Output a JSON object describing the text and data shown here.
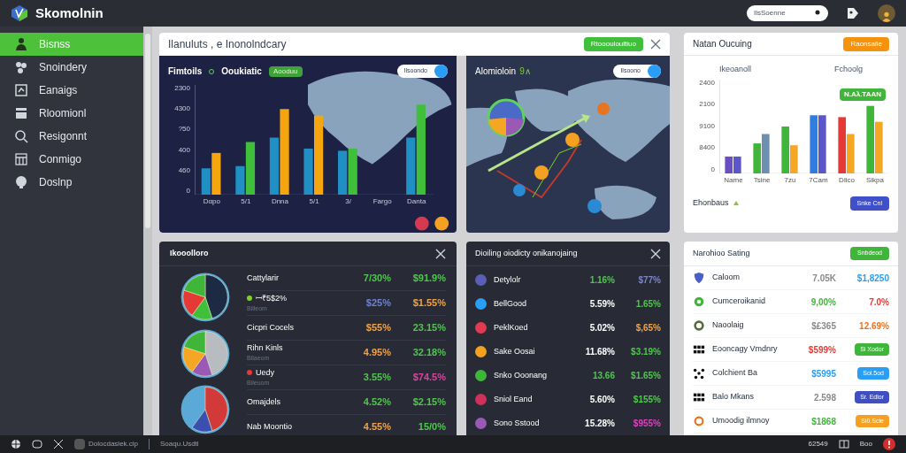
{
  "app": {
    "name": "Skomolnin"
  },
  "search": {
    "value": "IlsSoenne"
  },
  "sidebar": {
    "items": [
      {
        "label": "Bisnss",
        "selected": true
      },
      {
        "label": "Snoindery",
        "selected": false
      },
      {
        "label": "Eanaigs",
        "selected": false
      },
      {
        "label": "Rloomionl",
        "selected": false
      },
      {
        "label": "Resigonnt",
        "selected": false
      },
      {
        "label": "Conmigo",
        "selected": false
      },
      {
        "label": "Doslnp",
        "selected": false
      }
    ]
  },
  "overview": {
    "title": "Ilanuluts , e Inonolndcary",
    "badge": "Rtooouloultiuo",
    "chart_panel": {
      "title": "Fimtoils",
      "subtitle": "Ooukiatic",
      "badge": "Aooduu",
      "pill": "Ilsoondo",
      "axis_labels": [
        "2300",
        "4300",
        "?50",
        "400",
        "460",
        "0"
      ],
      "category_labels": [
        "Dαpo",
        "5/1",
        "Dnna",
        "5/1",
        "3/",
        "Fargo",
        "Danta"
      ]
    },
    "map_panel": {
      "title": "Alomioloin",
      "trend": "9∧",
      "pill": "Ilsoono"
    }
  },
  "outlook": {
    "title": "Natan Oucuing",
    "badge": "Raonsaile",
    "left_label": "Ikeoanoll",
    "right_label": "Fchoolg",
    "axis_labels": [
      "2400",
      "2100",
      "9100",
      "8400",
      "0"
    ],
    "category_labels": [
      "Name",
      "Tsine",
      "7zu",
      "7Cam",
      "Dlico",
      "Sikpa"
    ],
    "chart_badge": "Ν.Αλ.ΤΑΑΝ",
    "footer": "Ehonbaus",
    "button": "Snke Cnl"
  },
  "allocation": {
    "title": "Ikooolloro",
    "rows": [
      {
        "name": "Cattylarir",
        "share": {
          "text": "7/30%",
          "color": "#4cc94a"
        },
        "change": {
          "text": "$91.9%",
          "color": "#4cc94a"
        }
      },
      {
        "name": "ꟷ₹5$2%",
        "sub": "Billeom",
        "color": "#7ed321",
        "share": {
          "text": "$25%",
          "color": "#6b82d6"
        },
        "change": {
          "text": "$1.55%",
          "color": "#f5a240"
        }
      },
      {
        "name": "Cicpri Cocels",
        "share": {
          "text": "$55%",
          "color": "#f5a240"
        },
        "change": {
          "text": "23.15%",
          "color": "#4cc94a"
        }
      },
      {
        "name": "Rihn Kinls",
        "sub": "Bilaeom",
        "share": {
          "text": "4.95%",
          "color": "#f5a240"
        },
        "change": {
          "text": "32.18%",
          "color": "#4cc94a"
        }
      },
      {
        "name": "Uedy",
        "sub": "Bileuom",
        "color": "#e53935",
        "share": {
          "text": "3.55%",
          "color": "#4cc94a"
        },
        "change": {
          "text": "$74.5%",
          "color": "#e040a0"
        }
      },
      {
        "name": "Omajdels",
        "share": {
          "text": "4.52%",
          "color": "#4cc94a"
        },
        "change": {
          "text": "$2.15%",
          "color": "#4cc94a"
        }
      },
      {
        "name": "Nab Moontio",
        "share": {
          "text": "4.55%",
          "color": "#f5a240"
        },
        "change": {
          "text": "15/0%",
          "color": "#4cc94a"
        }
      }
    ]
  },
  "activity": {
    "title": "Dioiling oiodicty onikanojaing",
    "rows": [
      {
        "name": "Detylolr",
        "color": "#5a5fb5",
        "share": {
          "text": "1.16%",
          "color": "#4cc94a"
        },
        "change": {
          "text": "$77%",
          "color": "#7c84c8"
        }
      },
      {
        "name": "BellGood",
        "color": "#2a9df4",
        "share": {
          "text": "5.59%",
          "color": "#ffffff"
        },
        "change": {
          "text": "1.65%",
          "color": "#4cc94a"
        }
      },
      {
        "name": "PeklKoed",
        "color": "#e53950",
        "share": {
          "text": "5.02%",
          "color": "#ffffff"
        },
        "change": {
          "text": "$,65%",
          "color": "#f5a240"
        }
      },
      {
        "name": "Sake Oosai",
        "color": "#f5a020",
        "share": {
          "text": "11.68%",
          "color": "#ffffff"
        },
        "change": {
          "text": "$3.19%",
          "color": "#4cc94a"
        }
      },
      {
        "name": "Snko Ooonang",
        "color": "#3fb53a",
        "share": {
          "text": "13.66",
          "color": "#4cc94a"
        },
        "change": {
          "text": "$1.65%",
          "color": "#4cc94a"
        }
      },
      {
        "name": "Sniol Eand",
        "color": "#d0305a",
        "share": {
          "text": "5.60%",
          "color": "#ffffff"
        },
        "change": {
          "text": "$155%",
          "color": "#4cc94a"
        }
      },
      {
        "name": "Sono Sstood",
        "color": "#9b59b6",
        "share": {
          "text": "15.28%",
          "color": "#ffffff"
        },
        "change": {
          "text": "$955%",
          "color": "#e040c0"
        }
      }
    ]
  },
  "ranking": {
    "title": "Narohioo Sating",
    "badge": "Snbdeod",
    "rows": [
      {
        "name": "Caloom",
        "value": {
          "text": "7.05K",
          "color": "#8a8a8a"
        },
        "kind": "text",
        "result": {
          "text": "$1,8250",
          "color": "#2a9df4"
        }
      },
      {
        "name": "Cumceroikanid",
        "value": {
          "text": "9,00%",
          "color": "#3fb53a"
        },
        "kind": "text",
        "result": {
          "text": "7.0%",
          "color": "#e53935"
        }
      },
      {
        "name": "Naoolaig",
        "value": {
          "text": "$£365",
          "color": "#8a8a8a"
        },
        "kind": "text",
        "result": {
          "text": "12.69%",
          "color": "#f0701a"
        }
      },
      {
        "name": "Eooncagy Vmdnry",
        "value": {
          "text": "$599%",
          "color": "#e53935"
        },
        "kind": "badge",
        "result": {
          "text": "Si Xodor",
          "color": "#3fb53a"
        }
      },
      {
        "name": "Colchient Ba",
        "value": {
          "text": "$5995",
          "color": "#2a9df4"
        },
        "kind": "badge",
        "result": {
          "text": "Sol.5od",
          "color": "#2a9df4"
        }
      },
      {
        "name": "Balo Mkans",
        "value": {
          "text": "2.598",
          "color": "#8a8a8a"
        },
        "kind": "badge",
        "result": {
          "text": "Sr. Edlor",
          "color": "#3f4fc0"
        }
      },
      {
        "name": "Umoodig ilmnoy",
        "value": {
          "text": "$1868",
          "color": "#3fb53a"
        },
        "kind": "badge",
        "result": {
          "text": "Si0.Scie",
          "color": "#f5a020"
        }
      }
    ]
  },
  "taskbar": {
    "file": "Dolocdaslek.cip",
    "task": "Soaqu.Usdtl",
    "count": "62549",
    "label": "Boo"
  }
}
